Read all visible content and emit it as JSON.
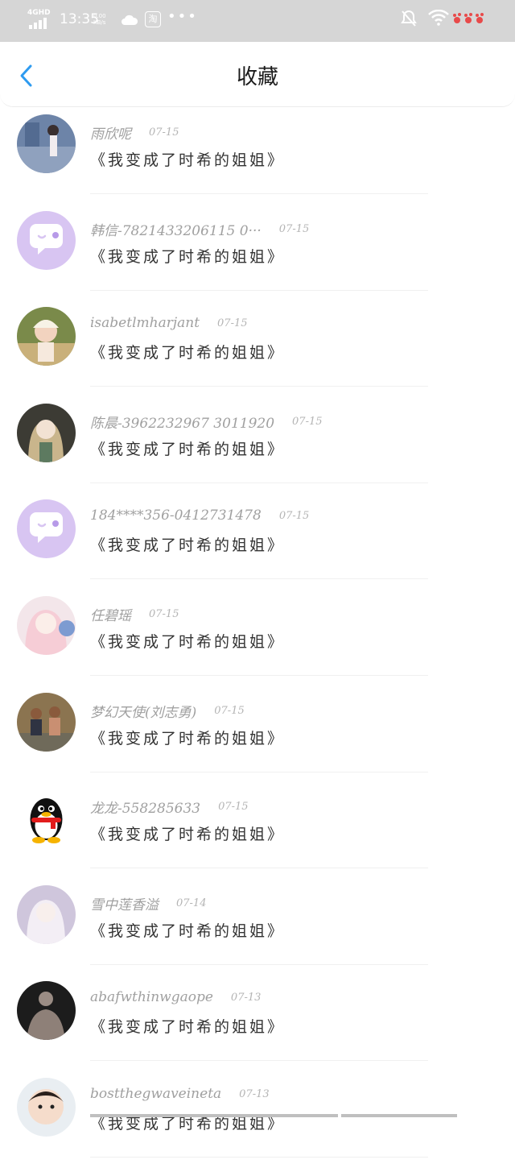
{
  "status_bar": {
    "network": "4GHD",
    "time": "13:35",
    "speed_value": "0.00",
    "speed_unit": "KB/s",
    "taobao_label": "淘",
    "more": "•••"
  },
  "header": {
    "title": "收藏",
    "back_icon": "chevron-left-icon",
    "accent_color": "#2e9bf0"
  },
  "items": [
    {
      "name": "雨欣呢",
      "date": "07-15",
      "content": "《我变成了时希的姐姐》",
      "avatar": "photo-girl-blue"
    },
    {
      "name": "韩信-7821433206115 0···",
      "date": "07-15",
      "content": "《我变成了时希的姐姐》",
      "avatar": "default-chat-bubble"
    },
    {
      "name": "isabetlmharjant",
      "date": "07-15",
      "content": "《我变成了时希的姐姐》",
      "avatar": "photo-child"
    },
    {
      "name": "陈晨-3962232967 3011920",
      "date": "07-15",
      "content": "《我变成了时希的姐姐》",
      "avatar": "anime-girl-dark"
    },
    {
      "name": "184****356-0412731478",
      "date": "07-15",
      "content": "《我变成了时希的姐姐》",
      "avatar": "default-chat-bubble"
    },
    {
      "name": "任碧瑶",
      "date": "07-15",
      "content": "《我变成了时希的姐姐》",
      "avatar": "anime-girl-pink"
    },
    {
      "name": "梦幻天使(刘志勇)",
      "date": "07-15",
      "content": "《我变成了时希的姐姐》",
      "avatar": "photo-family"
    },
    {
      "name": "龙龙-558285633",
      "date": "07-15",
      "content": "《我变成了时希的姐姐》",
      "avatar": "qq-penguin"
    },
    {
      "name": "雪中莲香溢",
      "date": "07-14",
      "content": "《我变成了时希的姐姐》",
      "avatar": "anime-girl-white"
    },
    {
      "name": "abafwthinwgaope",
      "date": "07-13",
      "content": "《我变成了时希的姐姐》",
      "avatar": "photo-muscle-man"
    },
    {
      "name": "bostthegwaveineta",
      "date": "07-13",
      "content": "《我变成了时希的姐姐》",
      "avatar": "photo-baby"
    }
  ]
}
